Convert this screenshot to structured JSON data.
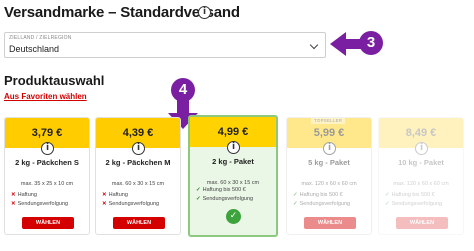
{
  "header": {
    "title": "Versandmarke – Standardversand",
    "info_icon": "info-icon"
  },
  "country_select": {
    "label": "ZIELLAND / ZIELREGION",
    "value": "Deutschland"
  },
  "callouts": [
    {
      "number": "3"
    },
    {
      "number": "4"
    }
  ],
  "section": {
    "title": "Produktauswahl",
    "favorites_link": "Aus Favoriten wählen"
  },
  "colors": {
    "accent_yellow": "#ffcc00",
    "brand_red": "#d40000",
    "callout_purple": "#7b1fa2",
    "selected_green": "#3da33d"
  },
  "products": [
    {
      "price": "3,79 €",
      "name": "2 kg - Päckchen S",
      "size": "max. 35 x 25 x 10 cm",
      "features": [
        {
          "mark": "✕",
          "text": "Haftung"
        },
        {
          "mark": "✕",
          "text": "Sendungsverfolgung"
        }
      ],
      "button": "WÄHLEN"
    },
    {
      "price": "4,39 €",
      "name": "2 kg - Päckchen M",
      "size": "max. 60 x 30 x 15 cm",
      "features": [
        {
          "mark": "✕",
          "text": "Haftung"
        },
        {
          "mark": "✕",
          "text": "Sendungsverfolgung"
        }
      ],
      "button": "WÄHLEN"
    },
    {
      "price": "4,99 €",
      "name": "2 kg - Paket",
      "size": "max. 60 x 30 x 15 cm",
      "features": [
        {
          "mark": "✓",
          "text": "Haftung bis 500 €"
        },
        {
          "mark": "✓",
          "text": "Sendungsverfolgung"
        }
      ],
      "selected": true
    },
    {
      "price": "5,99 €",
      "badge": "TOPSELLER",
      "name": "5 kg - Paket",
      "size": "max. 120 x 60 x 60 cm",
      "features": [
        {
          "mark": "✓",
          "text": "Haftung bis 500 €"
        },
        {
          "mark": "✓",
          "text": "Sendungsverfolgung"
        }
      ],
      "button": "WÄHLEN"
    },
    {
      "price": "8,49 €",
      "name": "10 kg - Paket",
      "size": "max. 120 x 60 x 60 cm",
      "features": [
        {
          "mark": "✓",
          "text": "Haftung bis 500 €"
        },
        {
          "mark": "✓",
          "text": "Sendungsverfolgung"
        }
      ],
      "button": "WÄHLEN"
    }
  ]
}
